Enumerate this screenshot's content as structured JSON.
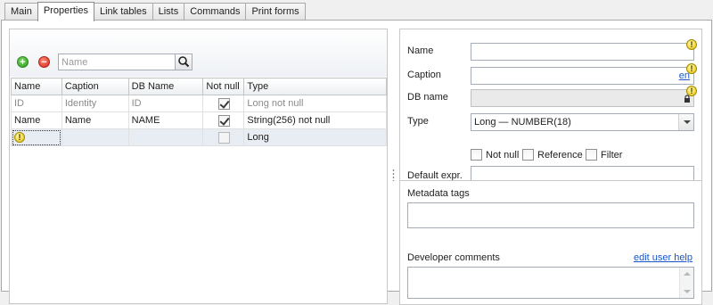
{
  "tabs": [
    "Main",
    "Properties",
    "Link tables",
    "Lists",
    "Commands",
    "Print forms"
  ],
  "active_tab": "Properties",
  "toolbar": {
    "add_icon": "plus-circle-icon",
    "remove_icon": "minus-circle-icon",
    "search_placeholder": "Name",
    "search_value": "",
    "search_icon": "magnifier-icon"
  },
  "grid": {
    "columns": [
      "Name",
      "Caption",
      "DB Name",
      "Not null",
      "Type"
    ],
    "rows": [
      {
        "name": "ID",
        "caption": "Identity",
        "db_name": "ID",
        "not_null": true,
        "type": "Long not null",
        "state": "disabled"
      },
      {
        "name": "Name",
        "caption": "Name",
        "db_name": "NAME",
        "not_null": true,
        "type": "String(256) not null",
        "state": "normal"
      },
      {
        "name": "",
        "caption": "",
        "db_name": "",
        "not_null": false,
        "type": "Long",
        "state": "new"
      }
    ]
  },
  "properties": {
    "name_label": "Name",
    "name_value": "",
    "caption_label": "Caption",
    "caption_value": "",
    "caption_lang": "en",
    "db_name_label": "DB name",
    "db_name_value": "",
    "type_label": "Type",
    "type_value": "Long — NUMBER(18)",
    "not_null_label": "Not null",
    "reference_label": "Reference",
    "filter_label": "Filter",
    "default_expr_label": "Default expr.",
    "default_expr_value": ""
  },
  "meta": {
    "tags_label": "Metadata tags",
    "dev_comments_label": "Developer comments",
    "help_link": "edit user help"
  },
  "colors": {
    "accent_link": "#1a56c9",
    "warning": "#e6c400",
    "add": "#2f9a1c",
    "remove": "#d3281a"
  }
}
